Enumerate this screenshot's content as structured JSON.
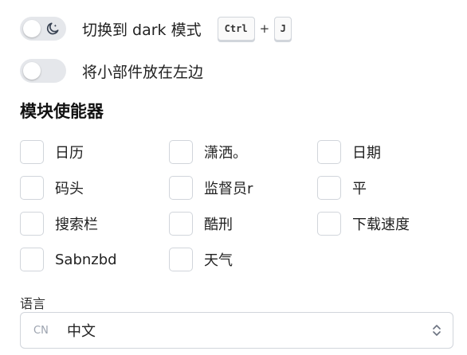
{
  "settings": {
    "dark_mode_label": "切换到 dark 模式",
    "shortcut_key1": "Ctrl",
    "shortcut_plus": "+",
    "shortcut_key2": "J",
    "widgets_left_label": "将小部件放在左边"
  },
  "modules": {
    "title": "模块使能器",
    "items": [
      {
        "label": "日历",
        "checked": false
      },
      {
        "label": "潇洒。",
        "checked": false
      },
      {
        "label": "日期",
        "checked": false
      },
      {
        "label": "码头",
        "checked": false
      },
      {
        "label": "监督员r",
        "checked": false
      },
      {
        "label": "平",
        "checked": false
      },
      {
        "label": "搜索栏",
        "checked": false
      },
      {
        "label": "酷刑",
        "checked": false
      },
      {
        "label": "下载速度",
        "checked": false
      },
      {
        "label": "Sabnzbd",
        "checked": false
      },
      {
        "label": "天气",
        "checked": false
      }
    ]
  },
  "language": {
    "label": "语言",
    "prefix": "CN",
    "value": "中文"
  },
  "colors": {
    "toggle_track": "#e5e7eb",
    "border": "#d1d5db"
  },
  "icons": {
    "dark_toggle": "moon-icon",
    "select_arrows": "chevron-up-down-icon"
  }
}
